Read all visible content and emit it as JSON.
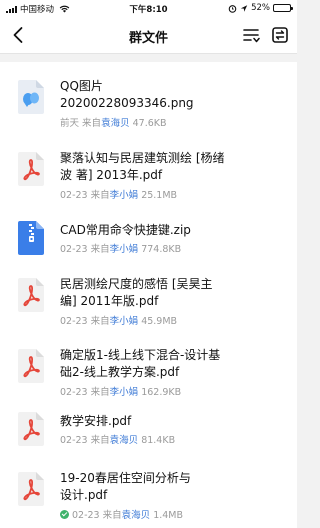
{
  "status_bar": {
    "carrier": "中国移动",
    "time": "下午8:10",
    "battery": "52%",
    "battery_level": 0.52
  },
  "navbar": {
    "title": "群文件"
  },
  "colors": {
    "sender": "#3f7bd6",
    "meta": "#9a9a9a",
    "pdf_red": "#e5463a",
    "zip_blue": "#3a7ee8",
    "qq_blue": "#4a9ef0",
    "check_green": "#3fb36b"
  },
  "files": [
    {
      "name_line1": "QQ图片",
      "name_line2": "20200228093346.png",
      "date": "前天",
      "from": "来自",
      "sender": "袁海贝",
      "size": "47.6KB",
      "icon": "qq-image-icon"
    },
    {
      "name_line1": "聚落认知与民居建筑测绘 [杨绪",
      "name_line2": "波 著] 2013年.pdf",
      "date": "02-23",
      "from": "来自",
      "sender": "李小娟",
      "size": "25.1MB",
      "icon": "pdf-icon"
    },
    {
      "name_line1": "CAD常用命令快捷键.zip",
      "name_line2": "",
      "date": "02-23",
      "from": "来自",
      "sender": "李小娟",
      "size": "774.8KB",
      "icon": "zip-icon"
    },
    {
      "name_line1": "民居测绘尺度的感悟 [吴昊主",
      "name_line2": "编] 2011年版.pdf",
      "date": "02-23",
      "from": "来自",
      "sender": "李小娟",
      "size": "45.9MB",
      "icon": "pdf-icon"
    },
    {
      "name_line1": "确定版1-线上线下混合-设计基",
      "name_line2": "础2-线上教学方案.pdf",
      "date": "02-23",
      "from": "来自",
      "sender": "李小娟",
      "size": "162.9KB",
      "icon": "pdf-icon"
    },
    {
      "name_line1": "教学安排.pdf",
      "name_line2": "",
      "date": "02-23",
      "from": "来自",
      "sender": "袁海贝",
      "size": "81.4KB",
      "icon": "pdf-icon"
    },
    {
      "name_line1": "19-20春居住空间分析与",
      "name_line2": "设计.pdf",
      "date": "02-23",
      "from": "来自",
      "sender": "袁海贝",
      "size": "1.4MB",
      "icon": "pdf-icon",
      "downloaded": true
    }
  ]
}
